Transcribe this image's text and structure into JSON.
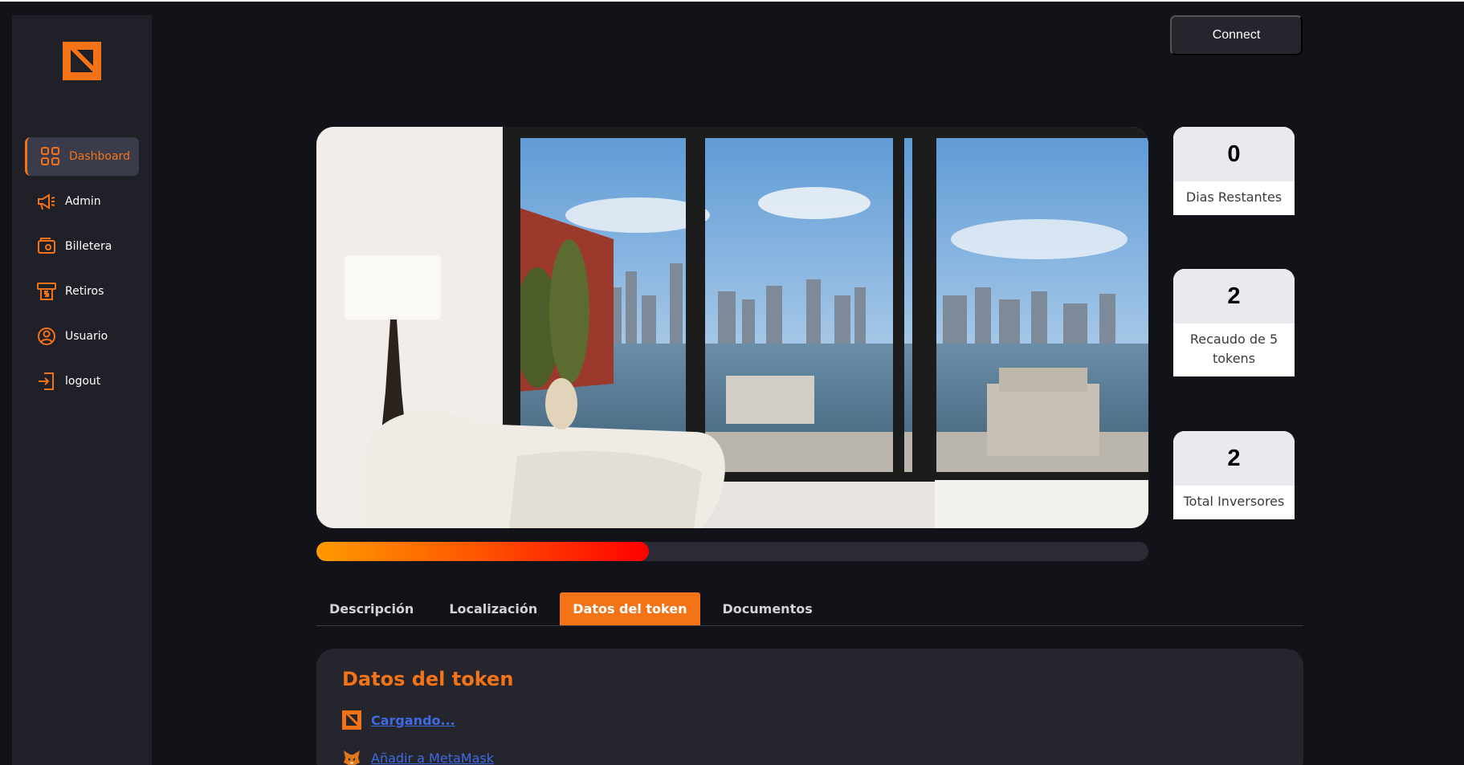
{
  "sidebar": {
    "logo": "brand-square-logo",
    "items": [
      {
        "label": "Dashboard",
        "icon": "grid-icon",
        "active": true
      },
      {
        "label": "Admin",
        "icon": "megaphone-icon"
      },
      {
        "label": "Billetera",
        "icon": "wallet-icon"
      },
      {
        "label": "Retiros",
        "icon": "dollar-withdraw-icon"
      },
      {
        "label": "Usuario",
        "icon": "user-circle-icon"
      },
      {
        "label": "logout",
        "icon": "logout-icon"
      }
    ]
  },
  "header": {
    "connect_label": "Connect"
  },
  "hero": {
    "image": "apartment-living-room-river-view-photo"
  },
  "stats": [
    {
      "value": "0",
      "label": "Dias Restantes"
    },
    {
      "value": "2",
      "label": "Recaudo de 5 tokens"
    },
    {
      "value": "2",
      "label": "Total Inversores"
    }
  ],
  "progress": {
    "fraction": 0.4
  },
  "tabs": [
    {
      "label": "Descripción"
    },
    {
      "label": "Localización"
    },
    {
      "label": "Datos del token",
      "active": true
    },
    {
      "label": "Documentos"
    }
  ],
  "token_panel": {
    "title": "Datos del token",
    "loading_link": "Cargando...",
    "metamask_link": "Añadir a MetaMask"
  },
  "colors": {
    "accent": "#f47317",
    "background": "#121318",
    "sidebar": "#1f2028",
    "link": "#4169e1"
  }
}
